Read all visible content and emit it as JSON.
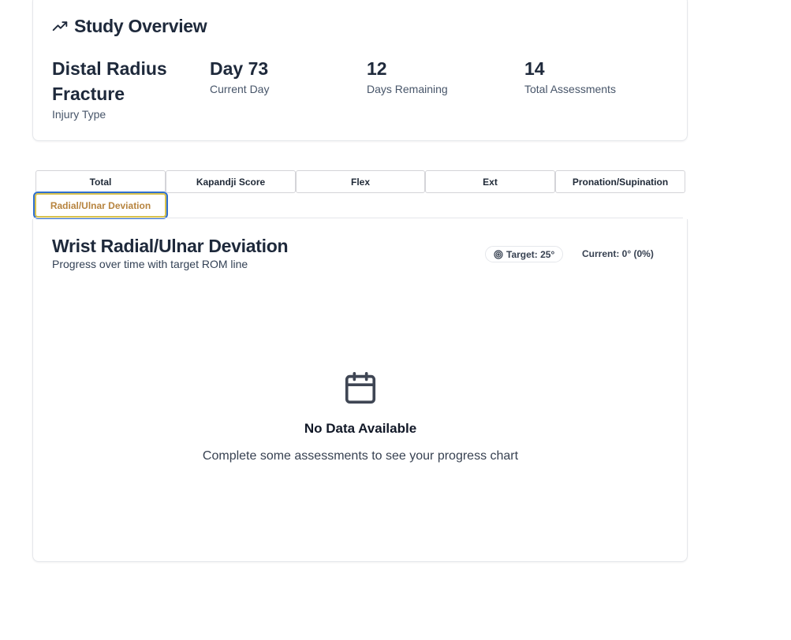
{
  "overview": {
    "title": "Study Overview",
    "icon": "trending-up-icon",
    "stats": {
      "injury": {
        "value": "Distal Radius Fracture",
        "label": "Injury Type"
      },
      "current_day": {
        "value": "Day 73",
        "label": "Current Day"
      },
      "days_remaining": {
        "value": "12",
        "label": "Days Remaining"
      },
      "total_assessments": {
        "value": "14",
        "label": "Total Assessments"
      }
    }
  },
  "tabs": [
    {
      "label": "Total"
    },
    {
      "label": "Kapandji Score"
    },
    {
      "label": "Flex"
    },
    {
      "label": "Ext"
    },
    {
      "label": "Pronation/Supination"
    },
    {
      "label": "Radial/Ulnar Deviation",
      "active": true
    }
  ],
  "chart_panel": {
    "title": "Wrist Radial/Ulnar Deviation",
    "subtitle": "Progress over time with target ROM line",
    "target_badge": "Target: 25°",
    "target_icon": "target-icon",
    "current": "Current: 0° (0%)",
    "empty_state": {
      "icon": "calendar-icon",
      "title": "No Data Available",
      "description": "Complete some assessments to see your progress chart"
    }
  },
  "colors": {
    "active_tab_text": "#b7843f",
    "active_tab_border": "#d8c24f",
    "focus_ring": "#2f6fd0",
    "heading": "#1e293b"
  }
}
